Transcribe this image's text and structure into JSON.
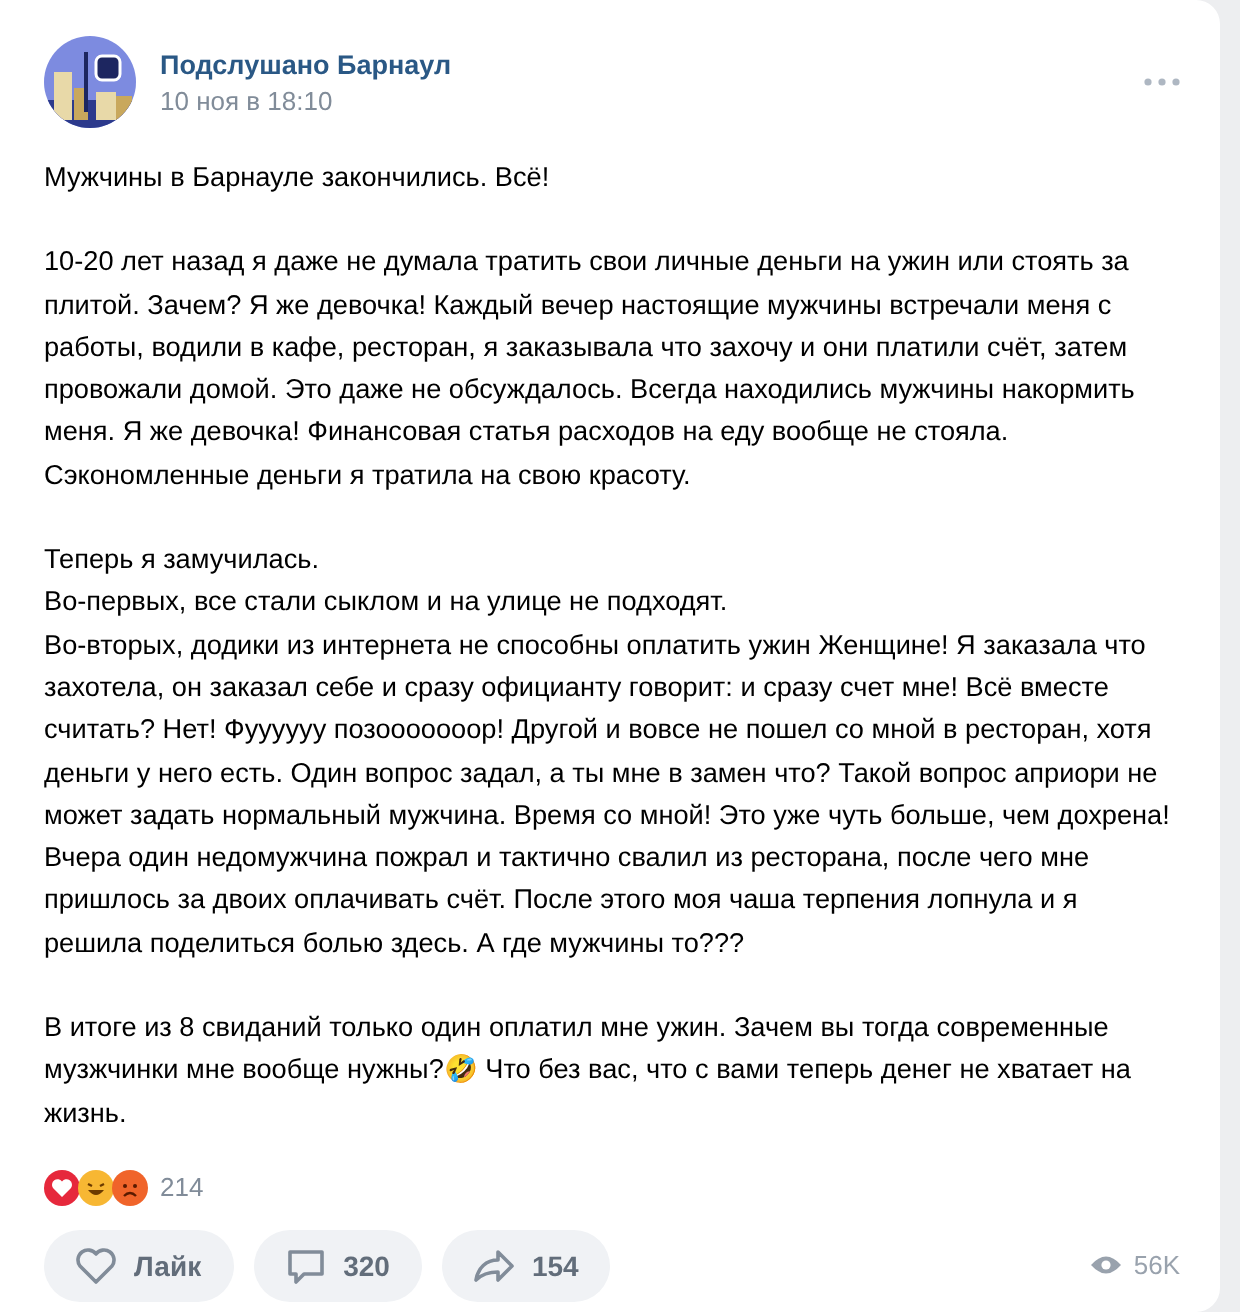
{
  "post": {
    "author": "Подслушано Барнаул",
    "date": "10 ноя в 18:10",
    "paragraphs": [
      [
        "Мужчины в Барнауле закончились. Всё!"
      ],
      [
        "10-20 лет назад я даже не думала тратить свои личные деньги на ужин или стоять за плитой. Зачем? Я же девочка! Каждый вечер настоящие мужчины встречали меня с работы, водили в кафе, ресторан, я заказывала что захочу и они платили счёт, затем провожали домой. Это даже не обсуждалось. Всегда находились мужчины накормить меня. Я же девочка! Финансовая статья расходов на еду вообще не стояла. Сэкономленные деньги я тратила на свою красоту."
      ],
      [
        "Теперь я замучилась.",
        "Во-первых, все стали сыклом и на улице не подходят.",
        "Во-вторых, додики из интернета не способны оплатить ужин Женщине! Я заказала что захотела, он заказал себе и сразу официанту говорит: и сразу счет мне! Всё вместе считать? Нет! Фуууууу позооооооор! Другой и вовсе не пошел со мной в ресторан, хотя деньги у него есть. Один вопрос задал, а ты мне в замен что? Такой вопрос априори не может задать нормальный мужчина. Время со мной! Это уже чуть больше, чем дохрена! Вчера один недомужчина пожрал и тактично свалил из ресторана, после чего мне пришлось за двоих оплачивать счёт. После этого моя чаша терпения лопнула и я решила поделиться болью здесь. А где мужчины то???"
      ],
      [
        "В итоге из 8 свиданий только один оплатил мне ужин. Зачем вы тогда современные музжчинки мне вообще нужны?🤣 Что без вас, что с вами теперь денег не хватает на жизнь."
      ]
    ],
    "reactions": {
      "count": "214",
      "items": [
        {
          "kind": "heart",
          "color": "#e6283c"
        },
        {
          "kind": "laugh",
          "color": "#f7b733"
        },
        {
          "kind": "angry",
          "color": "#f0642a"
        }
      ]
    },
    "actions": [
      {
        "kind": "like",
        "label": "Лайк"
      },
      {
        "kind": "comment",
        "label": "320"
      },
      {
        "kind": "share",
        "label": "154"
      }
    ],
    "views": "56K"
  }
}
